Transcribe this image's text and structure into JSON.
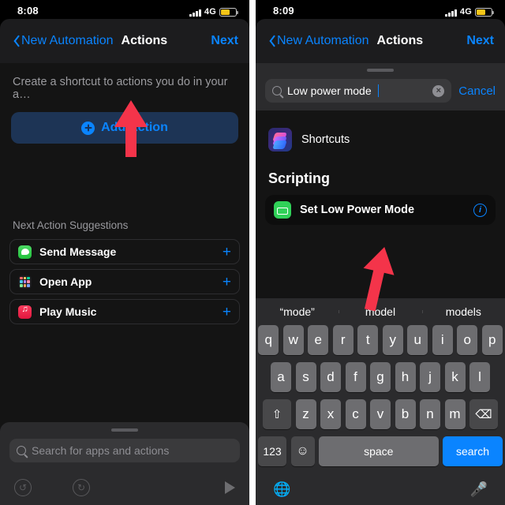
{
  "left": {
    "status": {
      "time": "8:08",
      "network": "4G",
      "signal_icon": "signal-bars-icon",
      "battery_icon": "battery-low-power-icon"
    },
    "nav": {
      "back_label": "New Automation",
      "title": "Actions",
      "next_label": "Next",
      "back_icon": "chevron-left-icon"
    },
    "subtitle": "Create a shortcut to actions you do in your a…",
    "add_action": {
      "label": "Add Action",
      "icon": "plus-circle-icon"
    },
    "suggestions_header": "Next Action Suggestions",
    "suggestions": [
      {
        "label": "Send Message",
        "icon": "messages-app-icon",
        "add_icon": "plus-icon"
      },
      {
        "label": "Open App",
        "icon": "open-app-icon",
        "add_icon": "plus-icon"
      },
      {
        "label": "Play Music",
        "icon": "music-app-icon",
        "add_icon": "plus-icon"
      }
    ],
    "search": {
      "placeholder": "Search for apps and actions",
      "icon": "search-icon"
    },
    "toolbar": {
      "undo_icon": "undo-icon",
      "redo_icon": "redo-icon",
      "play_icon": "play-icon"
    }
  },
  "right": {
    "status": {
      "time": "8:09",
      "network": "4G",
      "signal_icon": "signal-bars-icon",
      "battery_icon": "battery-low-power-icon"
    },
    "nav": {
      "back_label": "New Automation",
      "title": "Actions",
      "next_label": "Next",
      "back_icon": "chevron-left-icon"
    },
    "search": {
      "value": "Low power mode",
      "icon": "search-icon",
      "clear_icon": "clear-circle-icon",
      "cancel_label": "Cancel"
    },
    "app_result": {
      "label": "Shortcuts",
      "icon": "shortcuts-app-icon"
    },
    "group_header": "Scripting",
    "result": {
      "label": "Set Low Power Mode",
      "icon": "low-power-mode-icon",
      "info_icon": "info-circle-icon"
    },
    "keyboard": {
      "predictions": [
        "“mode”",
        "model",
        "models"
      ],
      "row1": [
        "q",
        "w",
        "e",
        "r",
        "t",
        "y",
        "u",
        "i",
        "o",
        "p"
      ],
      "row2": [
        "a",
        "s",
        "d",
        "f",
        "g",
        "h",
        "j",
        "k",
        "l"
      ],
      "row3": [
        "z",
        "x",
        "c",
        "v",
        "b",
        "n",
        "m"
      ],
      "shift_icon": "shift-icon",
      "backspace_icon": "backspace-icon",
      "numbers_label": "123",
      "emoji_icon": "emoji-icon",
      "space_label": "space",
      "return_label": "search",
      "globe_icon": "globe-icon",
      "mic_icon": "microphone-icon"
    }
  },
  "annotations": {
    "left_arrow": "red-arrow-up",
    "right_arrow": "red-arrow-up-tilted",
    "color": "#f4344a"
  }
}
